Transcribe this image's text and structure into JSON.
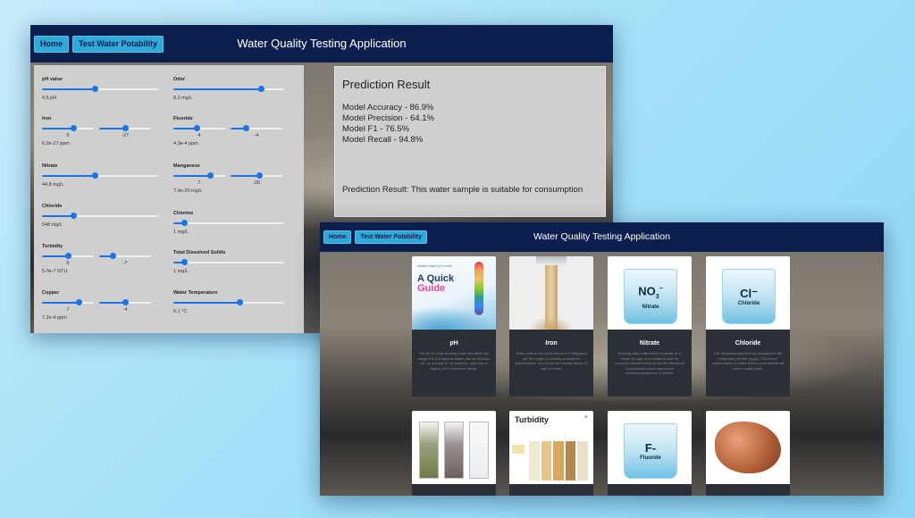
{
  "nav": {
    "home": "Home",
    "test": "Test Water Potability",
    "title": "Water Quality Testing Application"
  },
  "form": {
    "ph": {
      "label": "pH value",
      "value": "4.5 pH",
      "level": 0.45
    },
    "odor": {
      "label": "Odor",
      "value": "8.2 mg/L",
      "level": 0.8
    },
    "iron": {
      "label": "Iron",
      "n1": "6",
      "n2": "-27",
      "value": "6.0e-27 ppm",
      "l1": 0.6,
      "l2": 0.5
    },
    "fluoride": {
      "label": "Fluoride",
      "n1": "4",
      "n2": "-4",
      "value": "4.3e-4 ppm",
      "l1": 0.45,
      "l2": 0.3
    },
    "nitrate": {
      "label": "Nitrate",
      "value": "44.8 mg/L",
      "level": 0.45
    },
    "manganese": {
      "label": "Manganese",
      "n1": "7",
      "n2": "-20",
      "value": "7.4e-20 mg/L",
      "l1": 0.7,
      "l2": 0.55
    },
    "chloride": {
      "label": "Chloride",
      "value": "548 mg/L",
      "level": 0.27
    },
    "chlorine": {
      "label": "Chlorine",
      "value": "1 mg/L",
      "level": 0.1
    },
    "turbidity": {
      "label": "Turbidity",
      "n1": "5",
      "n2": "-7",
      "value": "5.0e-7 NTU",
      "l1": 0.5,
      "l2": 0.25
    },
    "tds": {
      "label": "Total Dissolved Solids",
      "value": "1 mg/L",
      "level": 0.1
    },
    "copper": {
      "label": "Copper",
      "n1": "7",
      "n2": "-4",
      "value": "7.2e-4 ppm",
      "l1": 0.7,
      "l2": 0.5
    },
    "temperature": {
      "label": "Water Temperature",
      "value": "6.1 °C",
      "level": 0.6
    }
  },
  "result": {
    "heading": "Prediction Result",
    "accuracy": "Model Accuracy - 86.9%",
    "precision": "Model Precision - 64.1%",
    "f1": "Model F1 - 76.5%",
    "recall": "Model Recall - 94.8%",
    "summary": "Prediction Result: This water sample is suitable for consumption"
  },
  "cards": {
    "ph": {
      "title": "pH",
      "text": "The pH of most drinking water lies within the range 6.5–8.5.Natural waters can be of lower pH, as a result of, for example, acid rain or higher pH in limestone areas.",
      "img_small": "Alkaline Water pH Levels",
      "img_big1": "A Quick",
      "img_big2": "Guide"
    },
    "iron": {
      "title": "Iron",
      "text": "Water with an iron level above 0.3 milligrams per liter (mg/L) is usually considered objectionable. Iron levels are usually below 10 mg/L in water."
    },
    "nitrate": {
      "title": "Nitrate",
      "text": "Drinking water with levels of nitrate at or below 10 mg/L is considered safe for everyone.Nitrate levels above the Maximum Contaminant Level may cause methemoglobinemia in infants.",
      "formula": "NO3",
      "name": "Nitrate"
    },
    "chloride": {
      "title": "Chloride",
      "text": "The recommended limit for chlorides is 250 milligrams per liter (mg/L). This is the concentration in water where most people will notice a salty taste.",
      "formula": "Cl⁻",
      "name": "Chloride"
    },
    "turbidity": {
      "img_title": "Turbidity"
    },
    "fluoride": {
      "formula": "F-",
      "name": "Fluoride"
    }
  },
  "colors": {
    "nav": "#0b1f4f",
    "button": "#2fa9d8",
    "slider": "#1a73e8"
  }
}
